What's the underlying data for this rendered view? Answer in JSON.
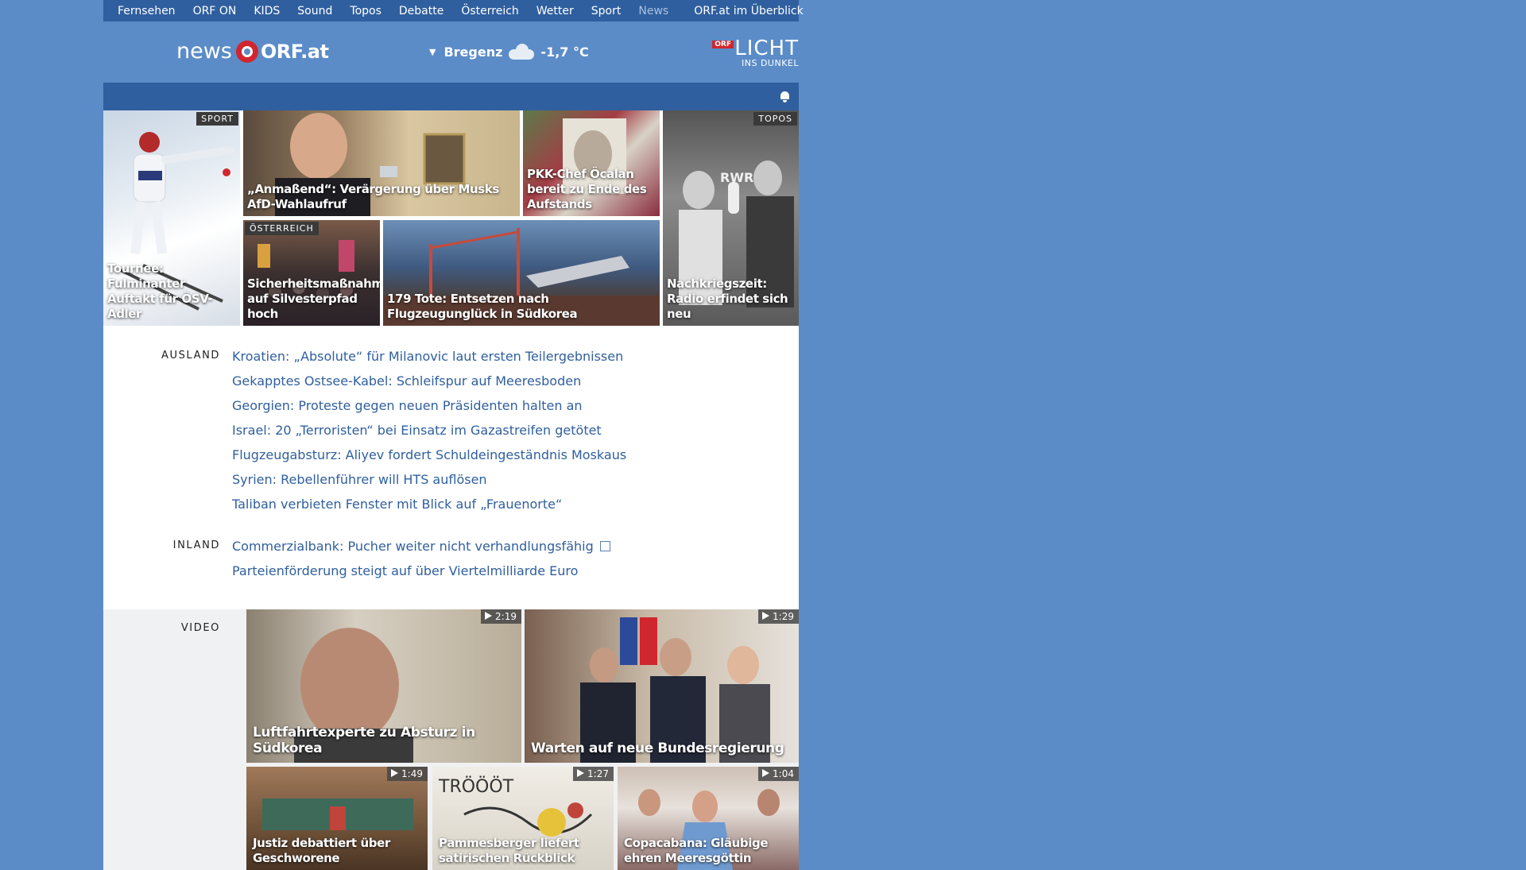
{
  "topnav": {
    "items": [
      "Fernsehen",
      "ORF ON",
      "KIDS",
      "Sound",
      "Topos",
      "Debatte",
      "Österreich",
      "Wetter",
      "Sport",
      "News"
    ],
    "overview": "ORF.at im Überblick"
  },
  "header": {
    "logo_news": "news",
    "logo_orf": "ORF.at",
    "weather_location": "Bregenz",
    "weather_temp": "-1,7 °C",
    "weather_icon": "cloud-icon",
    "licht_badge": "ORF",
    "licht_title": "LICHT",
    "licht_subtitle": "INS DUNKEL"
  },
  "teasers": [
    {
      "tag": "SPORT",
      "title": "Tournee: Fulminanter Auftakt für ÖSV-Adler"
    },
    {
      "tag": "",
      "title": "„Anmaßend“: Verärgerung über Musks AfD-Wahlaufruf"
    },
    {
      "tag": "",
      "title": "PKK-Chef Öcalan bereit zu Ende des Aufstands"
    },
    {
      "tag": "TOPOS",
      "title": "Nachkriegszeit: Radio erfindet sich neu"
    },
    {
      "tag": "ÖSTERREICH",
      "title": "Sicherheitsmaßnahmen auf Silvesterpfad hoch"
    },
    {
      "tag": "",
      "title": "179 Tote: Entsetzen nach Flugzeugunglück in Südkorea"
    }
  ],
  "ausland": {
    "label": "AUSLAND",
    "items": [
      "Kroatien: „Absolute“ für Milanovic laut ersten Teilergebnissen",
      "Gekapptes Ostsee-Kabel: Schleifspur auf Meeresboden",
      "Georgien: Proteste gegen neuen Präsidenten halten an",
      "Israel: 20 „Terroristen“ bei Einsatz im Gazastreifen getötet",
      "Flugzeugabsturz: Aliyev fordert Schuldeingeständnis Moskaus",
      "Syrien: Rebellenführer will HTS auflösen",
      "Taliban verbieten Fenster mit Blick auf „Frauenorte“"
    ]
  },
  "inland": {
    "label": "INLAND",
    "items": [
      "Commerzialbank: Pucher weiter nicht verhandlungsfähig",
      "Parteienförderung steigt auf über Viertelmilliarde Euro"
    ]
  },
  "video": {
    "label": "VIDEO",
    "items": [
      {
        "title": "Luftfahrtexperte zu Absturz in Südkorea",
        "duration": "2:19"
      },
      {
        "title": "Warten auf neue Bundesregierung",
        "duration": "1:29"
      },
      {
        "title": "Justiz debattiert über Geschworene",
        "duration": "1:49"
      },
      {
        "title": "Pammesberger liefert satirischen Rückblick",
        "duration": "1:27"
      },
      {
        "title": "Copacabana: Gläubige ehren Meeresgöttin",
        "duration": "1:04"
      }
    ]
  },
  "colors": {
    "background": "#5b8cc8",
    "nav": "#2f5f9e",
    "link": "#2f5f9e",
    "brand_red": "#d0262e"
  }
}
